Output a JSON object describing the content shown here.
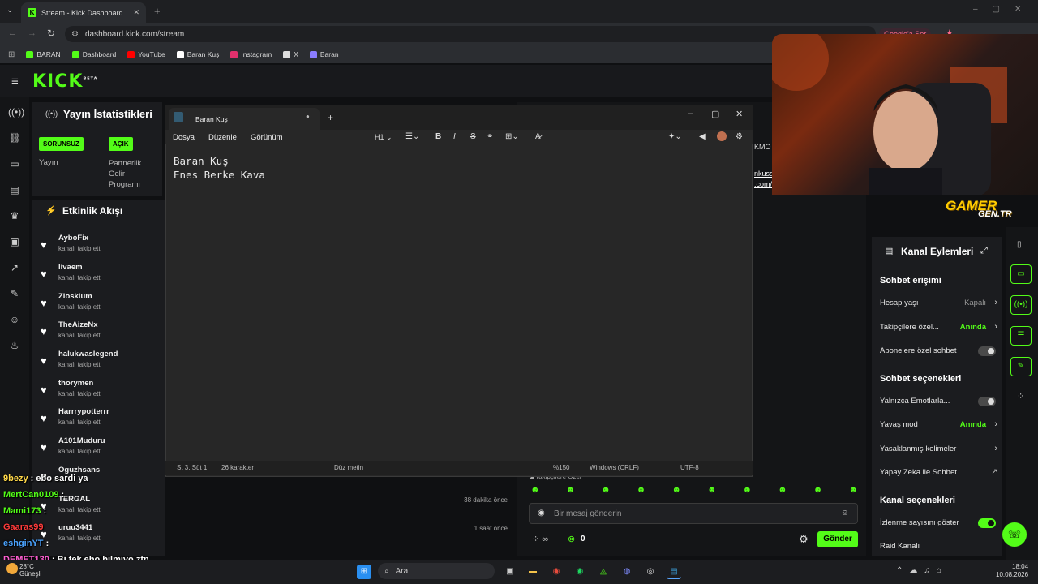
{
  "browser": {
    "tab_title": "Stream - Kick Dashboard",
    "url": "dashboard.kick.com/stream",
    "google_btn": "Google'a Sor",
    "bookmarks": [
      {
        "label": "BARAN",
        "icon": "kick-icon",
        "color": "#53fc18"
      },
      {
        "label": "Dashboard",
        "icon": "kick-icon",
        "color": "#53fc18"
      },
      {
        "label": "YouTube",
        "icon": "youtube-icon",
        "color": "#ff0000"
      },
      {
        "label": "Baran Kuş",
        "icon": "tiktok-icon",
        "color": "#ffffff"
      },
      {
        "label": "Instagram",
        "icon": "instagram-icon",
        "color": "#e1306c"
      },
      {
        "label": "X",
        "icon": "x-icon",
        "color": "#ffffff"
      },
      {
        "label": "Baran",
        "icon": "link-icon",
        "color": "#8a7cff"
      }
    ]
  },
  "kick": {
    "logo": "KICK",
    "logo_sup": "BETA",
    "stats": {
      "title": "Yayın İstatistikleri",
      "badge1": "SORUNSUZ",
      "label1": "Yayın",
      "badge2": "AÇIK",
      "label2_line1": "Partnerlik",
      "label2_line2": "Gelir",
      "label2_line3": "Programı"
    },
    "activity": {
      "title": "Etkinlik Akışı",
      "items": [
        {
          "name": "AyboFix",
          "sub": "kanalı takip etti",
          "time": ""
        },
        {
          "name": "livaem",
          "sub": "kanalı takip etti",
          "time": ""
        },
        {
          "name": "Zioskium",
          "sub": "kanalı takip etti",
          "time": ""
        },
        {
          "name": "TheAizeNx",
          "sub": "kanalı takip etti",
          "time": ""
        },
        {
          "name": "halukwaslegend",
          "sub": "kanalı takip etti",
          "time": ""
        },
        {
          "name": "thorymen",
          "sub": "kanalı takip etti",
          "time": ""
        },
        {
          "name": "Harrrypotterrr",
          "sub": "kanalı takip etti",
          "time": ""
        },
        {
          "name": "A101Muduru",
          "sub": "kanalı takip etti",
          "time": ""
        },
        {
          "name": "Oguzhsans",
          "sub": "",
          "time": ""
        },
        {
          "name": "TERGAL",
          "sub": "kanalı takip etti",
          "time": "38 dakika önce"
        },
        {
          "name": "uruu3441",
          "sub": "kanalı takip etti",
          "time": "1 saat önce"
        }
      ]
    },
    "chat": {
      "placeholder": "Bir mesaj gönderin",
      "send": "Gönder",
      "followers_label": "Takipçilere Özel",
      "count": "0",
      "links": [
        "nkuss",
        ".com/@barankusss"
      ],
      "partial_label": "KMO"
    },
    "actions": {
      "title": "Kanal Eylemleri",
      "sec1": "Sohbet erişimi",
      "r1": "Hesap yaşı",
      "r1v": "Kapalı",
      "r2": "Takipçilere özel...",
      "r2v": "Anında",
      "r3": "Abonelere özel sohbet",
      "sec2": "Sohbet seçenekleri",
      "r4": "Yalnızca Emotlarla...",
      "r5": "Yavaş mod",
      "r5v": "Anında",
      "r6": "Yasaklanmış kelimeler",
      "r7": "Yapay Zeka ile Sohbet...",
      "sec3": "Kanal seçenekleri",
      "r8": "İzlenme sayısını göster",
      "r9": "Raid Kanalı",
      "gamer_line1": "GAMER",
      "gamer_line2": "GEN.TR"
    }
  },
  "notepad": {
    "tab_title": "Baran Kuş",
    "menu": [
      "Dosya",
      "Düzenle",
      "Görünüm"
    ],
    "heading": "H1",
    "line1": "Baran Kuş",
    "line2": "Enes Berke Kava",
    "status_pos": "St 3, Süt 1",
    "status_chars": "26 karakter",
    "status_mode": "Düz metin",
    "status_zoom": "%150",
    "status_eol": "Windows (CRLF)",
    "status_enc": "UTF-8"
  },
  "overlay_chat": [
    {
      "user": "9bezy",
      "msg": " : ebo sardi ya",
      "color": "#ffd84a"
    },
    {
      "user": "MertCan0109",
      "msg": " :",
      "color": "#53fc18"
    },
    {
      "user": "Mami173",
      "msg": " :",
      "color": "#53fc18"
    },
    {
      "user": "Gaaras99",
      "msg": "",
      "color": "#ff3b3b"
    },
    {
      "user": "eshginYT",
      "msg": " :",
      "color": "#4aa3ff"
    },
    {
      "user": "DEMET130",
      "msg": " : Bi tek ebo bilmiyo ztn",
      "color": "#ff5fd2"
    }
  ],
  "taskbar": {
    "weather_temp": "28°C",
    "weather_desc": "Güneşli",
    "search": "Ara",
    "time": "18:04",
    "date": "10.08.2026"
  }
}
